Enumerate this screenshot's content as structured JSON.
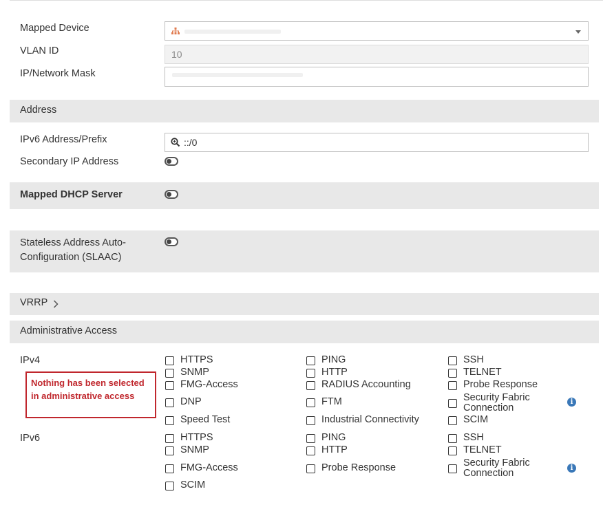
{
  "fields": {
    "mapped_device_label": "Mapped Device",
    "vlan_id_label": "VLAN ID",
    "vlan_id_value": "10",
    "ip_mask_label": "IP/Network Mask",
    "ipv6_prefix_label": "IPv6 Address/Prefix",
    "ipv6_prefix_value": "::/0",
    "secondary_ip_label": "Secondary IP Address",
    "mapped_dhcp_label": "Mapped DHCP Server",
    "slaac_label_line1": "Stateless Address Auto-",
    "slaac_label_line2": "Configuration (SLAAC)"
  },
  "toggles": {
    "secondary_ip": false,
    "mapped_dhcp": false,
    "slaac": false
  },
  "sections": {
    "address": "Address",
    "vrrp": "VRRP",
    "admin_access": "Administrative Access"
  },
  "admin": {
    "ipv4_label": "IPv4",
    "ipv6_label": "IPv6",
    "ipv4": {
      "col1": [
        "HTTPS",
        "SNMP",
        "FMG-Access",
        "DNP",
        "Speed Test"
      ],
      "col2": [
        "PING",
        "HTTP",
        "RADIUS Accounting",
        "FTM",
        "Industrial Connectivity"
      ],
      "col3": [
        "SSH",
        "TELNET",
        "Probe Response",
        "Security Fabric",
        "SCIM"
      ],
      "col3_fabric_line2": "Connection"
    },
    "ipv6": {
      "col1": [
        "HTTPS",
        "SNMP",
        "FMG-Access",
        "SCIM"
      ],
      "col2": [
        "PING",
        "HTTP",
        "Probe Response"
      ],
      "col3": [
        "SSH",
        "TELNET",
        "Security Fabric"
      ],
      "col3_fabric_line2": "Connection"
    },
    "all_checked": false
  },
  "annotation": {
    "text": "Nothing has been selected in administrative access",
    "color": "#c0272d"
  },
  "icons": {
    "info": "i",
    "search": "search-icon",
    "device": "network-device-icon"
  },
  "colors": {
    "band": "#e8e8e8",
    "info": "#3a78b8"
  }
}
